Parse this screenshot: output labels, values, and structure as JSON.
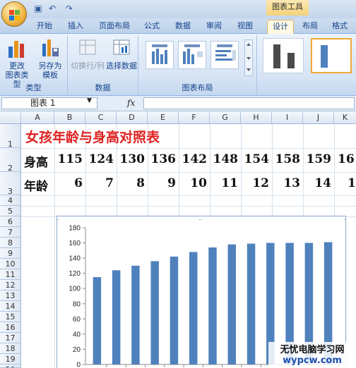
{
  "titlebar": {
    "context_tab_title": "图表工具",
    "quick_access": [
      "save-icon",
      "undo-icon",
      "redo-icon"
    ]
  },
  "tabs": [
    {
      "label": "开始",
      "active": false
    },
    {
      "label": "插入",
      "active": false
    },
    {
      "label": "页面布局",
      "active": false
    },
    {
      "label": "公式",
      "active": false
    },
    {
      "label": "数据",
      "active": false
    },
    {
      "label": "审阅",
      "active": false
    },
    {
      "label": "视图",
      "active": false
    },
    {
      "label": "设计",
      "active": true
    },
    {
      "label": "布局",
      "active": false
    },
    {
      "label": "格式",
      "active": false
    }
  ],
  "ribbon": {
    "groups": {
      "type": "类型",
      "data": "数据",
      "layout": "图表布局"
    },
    "buttons": {
      "change_type_line1": "更改",
      "change_type_line2": "图表类型",
      "save_template_line1": "另存为",
      "save_template_line2": "模板",
      "switch_row_col": "切换行/列",
      "select_data": "选择数据"
    }
  },
  "formula_bar": {
    "name_box": "图表 1",
    "fx_label": "fx",
    "formula": ""
  },
  "columns": [
    "A",
    "B",
    "C",
    "D",
    "E",
    "F",
    "G",
    "H",
    "I",
    "J",
    "K"
  ],
  "rows": [
    "1",
    "2",
    "3",
    "4",
    "5",
    "6",
    "7",
    "8",
    "9",
    "10",
    "11",
    "12",
    "13",
    "14",
    "15",
    "16",
    "17",
    "18",
    "19",
    "20"
  ],
  "sheet": {
    "title": "女孩年龄与身高对照表",
    "height_label": "身高",
    "age_label": "年龄",
    "heights": [
      "115",
      "124",
      "130",
      "136",
      "142",
      "148",
      "154",
      "158",
      "159",
      "16"
    ],
    "ages": [
      "6",
      "7",
      "8",
      "9",
      "10",
      "11",
      "12",
      "13",
      "14",
      "1"
    ]
  },
  "chart_data": {
    "type": "bar",
    "values": [
      115,
      124,
      130,
      136,
      142,
      148,
      154,
      158,
      159,
      160,
      160,
      160,
      161
    ],
    "ylim": [
      0,
      180
    ],
    "yticks": [
      "0",
      "20",
      "40",
      "60",
      "80",
      "100",
      "120",
      "140",
      "160",
      "180"
    ],
    "grid": false,
    "bar_color": "#4f81bd"
  },
  "watermark": {
    "line1": "无忧电脑学习网",
    "line2": "wypcw.com"
  },
  "colors": {
    "accent": "#15428b",
    "title_red": "#e02020",
    "active_tab": "#fff9e4"
  }
}
